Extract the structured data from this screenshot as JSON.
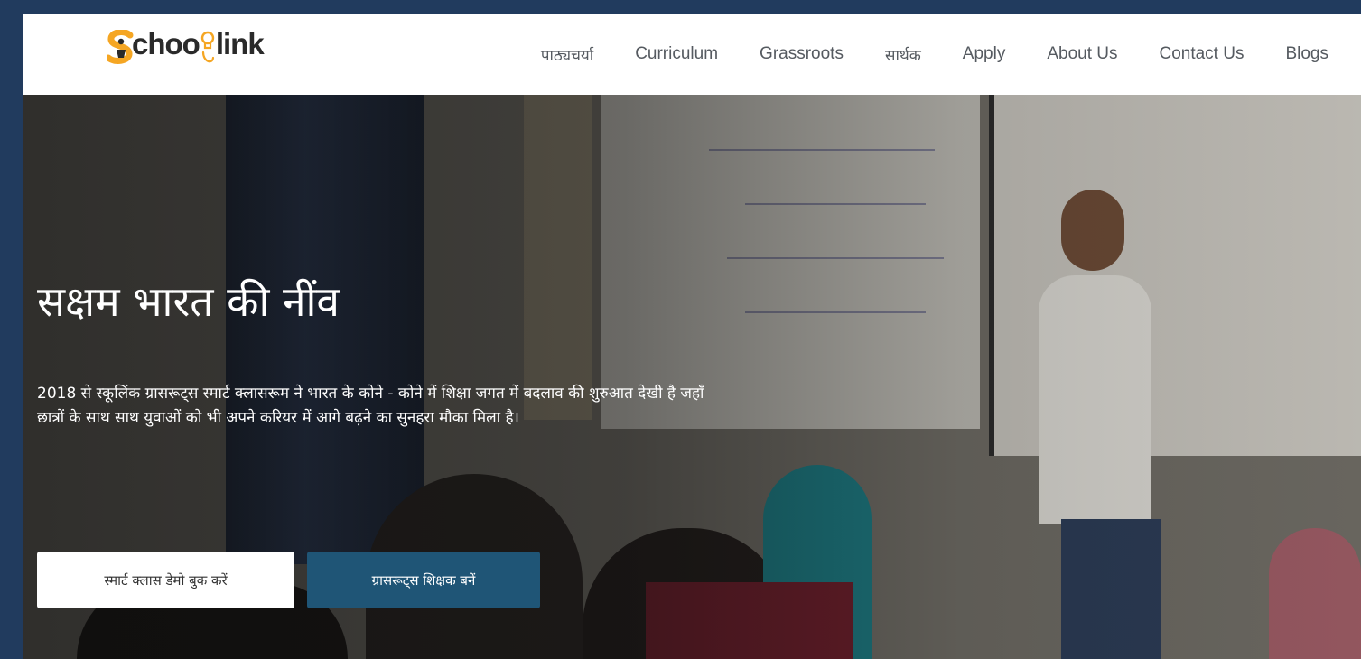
{
  "brand": {
    "logo_text_prefix": "choo",
    "logo_text_suffix": "link",
    "accent": "#f5a623"
  },
  "nav": {
    "items": [
      {
        "label": "पाठ्यचर्या"
      },
      {
        "label": "Curriculum"
      },
      {
        "label": "Grassroots"
      },
      {
        "label": "सार्थक"
      },
      {
        "label": "Apply"
      },
      {
        "label": "About Us"
      },
      {
        "label": "Contact Us"
      },
      {
        "label": "Blogs"
      }
    ]
  },
  "hero": {
    "title": "सक्षम भारत की नींव",
    "description": "2018 से स्कूलिंक ग्रासरूट्स स्मार्ट क्लासरूम ने भारत के कोने - कोने में शिक्षा जगत में बदलाव की शुरुआत देखी है जहाँ छात्रों के साथ साथ युवाओं को भी अपने करियर में आगे बढ़ने का सुनहरा मौका मिला है।",
    "primary_button": "स्मार्ट क्लास डेमो बुक करें",
    "secondary_button": "ग्रासरूट्स शिक्षक बनें",
    "secondary_button_color": "#1f5576"
  },
  "icons": {
    "logo_mark": "schoolink-s-mark-icon",
    "logo_bulb": "lightbulb-icon"
  }
}
